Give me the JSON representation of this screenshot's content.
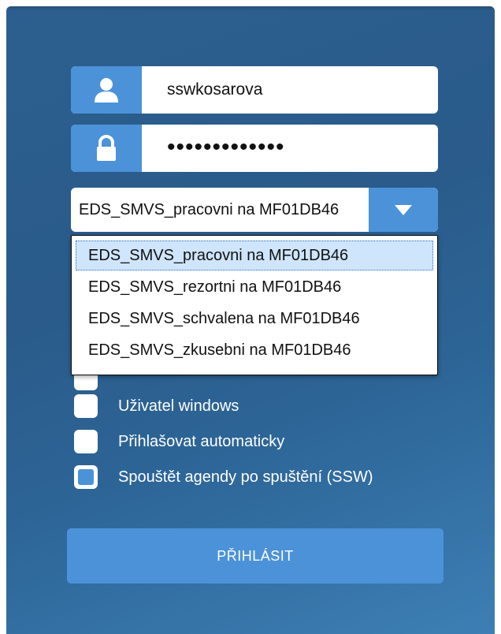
{
  "login": {
    "username_icon": "user-icon",
    "username": "sswkosarova",
    "password_icon": "lock-icon",
    "password_masked": "•••••••••••••",
    "database": {
      "selected": "EDS_SMVS_pracovni na MF01DB46",
      "arrow_icon": "triangle-down-icon",
      "options": [
        "EDS_SMVS_pracovni na MF01DB46",
        "EDS_SMVS_rezortni na MF01DB46",
        "EDS_SMVS_schvalena na MF01DB46",
        "EDS_SMVS_zkusebni na MF01DB46"
      ]
    },
    "checkboxes": [
      {
        "label": "Uživatel windows",
        "checked": false
      },
      {
        "label": "Přihlašovat automaticky",
        "checked": false
      },
      {
        "label": "Spouštět agendy po spuštění (SSW)",
        "checked": true
      }
    ],
    "submit_label": "PŘIHLÁSIT"
  },
  "colors": {
    "accent": "#4b92d8",
    "panel_dark": "#2a5b8a",
    "panel_light": "#3d7fb4"
  }
}
